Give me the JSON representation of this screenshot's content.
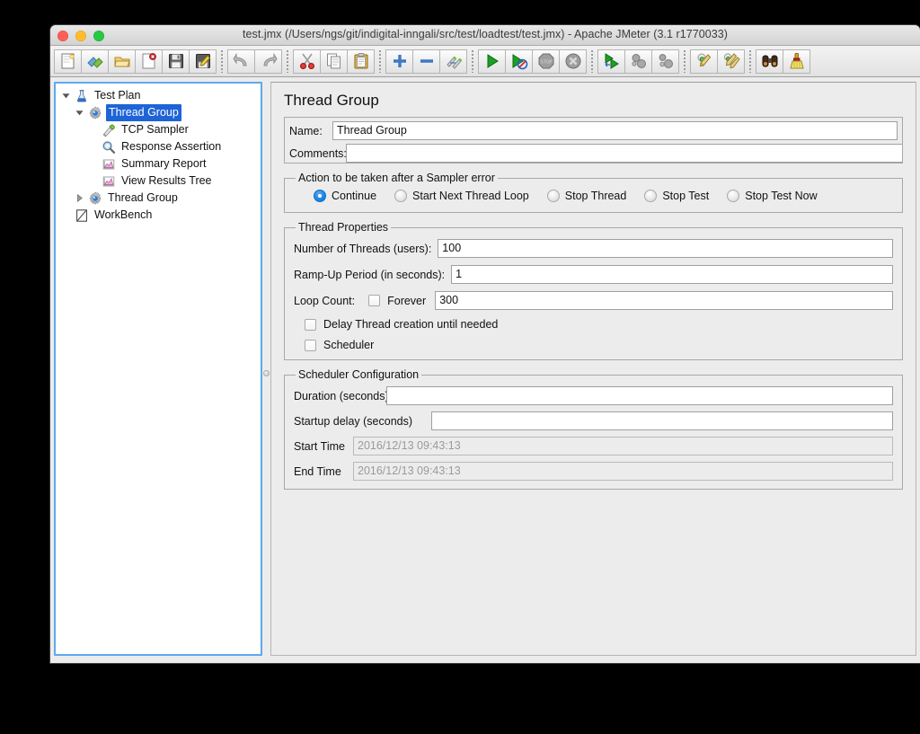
{
  "window": {
    "title": "test.jmx (/Users/ngs/git/indigital-inngali/src/test/loadtest/test.jmx) - Apache JMeter (3.1 r1770033)",
    "close_label": "close",
    "minimize_label": "minimize",
    "maximize_label": "maximize"
  },
  "toolbar": {
    "groups": [
      {
        "buttons": [
          {
            "name": "new-test-plan-button",
            "icon": "new-document-icon",
            "label": "New"
          },
          {
            "name": "templates-button",
            "icon": "templates-icon",
            "label": "Templates"
          },
          {
            "name": "open-button",
            "icon": "open-folder-icon",
            "label": "Open"
          },
          {
            "name": "close-button",
            "icon": "close-document-icon",
            "label": "Close"
          },
          {
            "name": "save-button",
            "icon": "floppy-disk-icon",
            "label": "Save"
          },
          {
            "name": "save-as-button",
            "icon": "save-as-pencil-icon",
            "label": "Save Test Plan as"
          }
        ]
      },
      {
        "buttons": [
          {
            "name": "undo-button",
            "icon": "undo-arrow-icon",
            "label": "Undo"
          },
          {
            "name": "redo-button",
            "icon": "redo-arrow-icon",
            "label": "Redo"
          }
        ]
      },
      {
        "buttons": [
          {
            "name": "cut-button",
            "icon": "scissors-icon",
            "label": "Cut"
          },
          {
            "name": "copy-button",
            "icon": "copy-pages-icon",
            "label": "Copy"
          },
          {
            "name": "paste-button",
            "icon": "clipboard-icon",
            "label": "Paste"
          }
        ]
      },
      {
        "buttons": [
          {
            "name": "expand-all-button",
            "icon": "plus-icon",
            "label": "Expand All"
          },
          {
            "name": "collapse-all-button",
            "icon": "minus-icon",
            "label": "Collapse All"
          },
          {
            "name": "toggle-button",
            "icon": "toggle-eyedroppers-icon",
            "label": "Toggle"
          }
        ]
      },
      {
        "buttons": [
          {
            "name": "start-button",
            "icon": "play-green-icon",
            "label": "Start"
          },
          {
            "name": "start-no-pauses-button",
            "icon": "play-no-pauses-icon",
            "label": "Start no pauses"
          },
          {
            "name": "stop-button",
            "icon": "stop-sign-icon",
            "label": "Stop"
          },
          {
            "name": "shutdown-button",
            "icon": "shutdown-x-icon",
            "label": "Shutdown"
          }
        ]
      },
      {
        "buttons": [
          {
            "name": "remote-start-all-button",
            "icon": "remote-start-all-icon",
            "label": "Remote Start All"
          },
          {
            "name": "remote-stop-all-button",
            "icon": "remote-stop-all-icon",
            "label": "Remote Stop All"
          },
          {
            "name": "remote-shutdown-all-button",
            "icon": "remote-shutdown-all-icon",
            "label": "Remote Shutdown All"
          }
        ]
      },
      {
        "buttons": [
          {
            "name": "clear-button",
            "icon": "broom-clear-icon",
            "label": "Clear"
          },
          {
            "name": "clear-all-button",
            "icon": "broom-clear-all-icon",
            "label": "Clear All"
          }
        ]
      },
      {
        "buttons": [
          {
            "name": "search-button",
            "icon": "binoculars-icon",
            "label": "Search"
          },
          {
            "name": "reset-search-button",
            "icon": "broom-reset-search-icon",
            "label": "Reset Search"
          }
        ]
      }
    ]
  },
  "tree": {
    "nodes": [
      {
        "label": "Test Plan",
        "depth": 0,
        "twisty": "open",
        "icon": "test-plan-flask-icon",
        "selected": false
      },
      {
        "label": "Thread Group",
        "depth": 1,
        "twisty": "open",
        "icon": "thread-group-gear-icon",
        "selected": true
      },
      {
        "label": "TCP Sampler",
        "depth": 2,
        "twisty": "none",
        "icon": "tcp-sampler-pipette-icon",
        "selected": false
      },
      {
        "label": "Response Assertion",
        "depth": 2,
        "twisty": "none",
        "icon": "assertion-magnifier-icon",
        "selected": false
      },
      {
        "label": "Summary Report",
        "depth": 2,
        "twisty": "none",
        "icon": "report-chart-icon",
        "selected": false
      },
      {
        "label": "View Results Tree",
        "depth": 2,
        "twisty": "none",
        "icon": "report-chart-icon",
        "selected": false
      },
      {
        "label": "Thread Group",
        "depth": 1,
        "twisty": "closed",
        "icon": "thread-group-gear-icon",
        "selected": false
      },
      {
        "label": "WorkBench",
        "depth": 0,
        "twisty": "none",
        "icon": "workbench-icon",
        "selected": false
      }
    ]
  },
  "main": {
    "panel_title": "Thread Group",
    "name_label": "Name:",
    "name_value": "Thread Group",
    "comments_label": "Comments:",
    "comments_value": "",
    "sampler_error": {
      "legend": "Action to be taken after a Sampler error",
      "options": [
        {
          "label": "Continue",
          "selected": true
        },
        {
          "label": "Start Next Thread Loop",
          "selected": false
        },
        {
          "label": "Stop Thread",
          "selected": false
        },
        {
          "label": "Stop Test",
          "selected": false
        },
        {
          "label": "Stop Test Now",
          "selected": false
        }
      ]
    },
    "thread_properties": {
      "legend": "Thread Properties",
      "num_threads_label": "Number of Threads (users):",
      "num_threads_value": "100",
      "ramp_up_label": "Ramp-Up Period (in seconds):",
      "ramp_up_value": "1",
      "loop_count_label": "Loop Count:",
      "forever_label": "Forever",
      "forever_checked": false,
      "loop_count_value": "300",
      "delay_thread_label": "Delay Thread creation until needed",
      "delay_thread_checked": false,
      "scheduler_label": "Scheduler",
      "scheduler_checked": false
    },
    "scheduler_configuration": {
      "legend": "Scheduler Configuration",
      "duration_label": "Duration (seconds)",
      "duration_value": "",
      "startup_delay_label": "Startup delay (seconds)",
      "startup_delay_value": "",
      "start_time_label": "Start Time",
      "start_time_value": "2016/12/13 09:43:13",
      "end_time_label": "End Time",
      "end_time_value": "2016/12/13 09:43:13"
    }
  },
  "colors": {
    "selection_blue": "#1e64d7",
    "focus_border_blue": "#5ea9ef",
    "radio_on_blue": "#1886e8",
    "window_chrome": "#ececec",
    "readonly_text": "#9a9a9a"
  }
}
